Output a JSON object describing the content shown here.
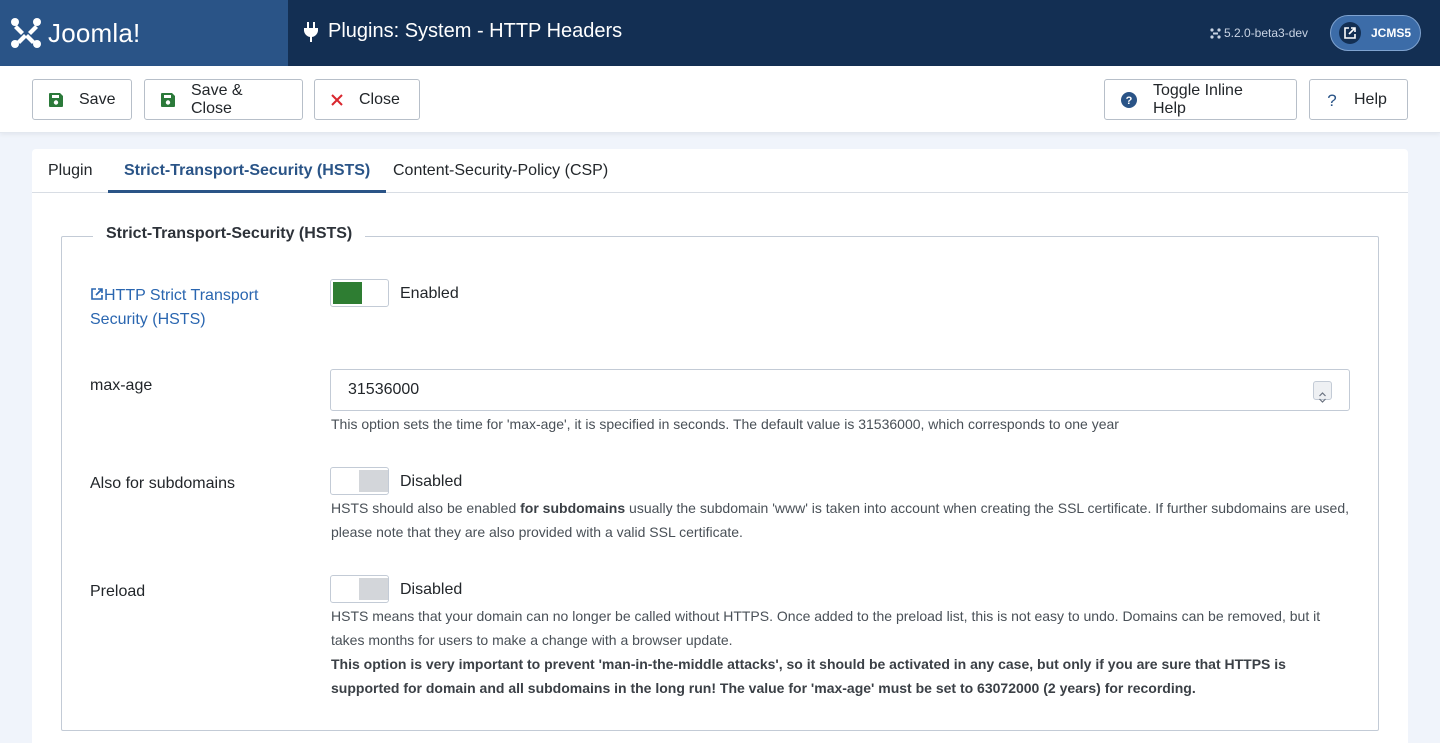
{
  "header": {
    "logo_text": "Joomla!",
    "page_title": "Plugins: System - HTTP Headers",
    "version": "5.2.0-beta3-dev",
    "site_label": "JCMS5"
  },
  "toolbar": {
    "save": "Save",
    "save_close": "Save & Close",
    "close": "Close",
    "toggle_help": "Toggle Inline Help",
    "help": "Help"
  },
  "tabs": [
    "Plugin",
    "Strict-Transport-Security (HSTS)",
    "Content-Security-Policy (CSP)"
  ],
  "active_tab": "Strict-Transport-Security (HSTS)",
  "fieldset": {
    "legend": "Strict-Transport-Security (HSTS)",
    "hsts": {
      "label": "HTTP Strict Transport Security (HSTS)",
      "state": "Enabled"
    },
    "max_age": {
      "label": "max-age",
      "value": "31536000",
      "description": "This option sets the time for 'max-age', it is specified in seconds. The default value is 31536000, which corresponds to one year"
    },
    "subdomains": {
      "label": "Also for subdomains",
      "state": "Disabled",
      "desc_pre": "HSTS should also be enabled ",
      "desc_bold": "for subdomains",
      "desc_post": " usually the subdomain 'www' is taken into account when creating the SSL certificate. If further subdomains are used, please note that they are also provided with a valid SSL certificate."
    },
    "preload": {
      "label": "Preload",
      "state": "Disabled",
      "description": "HSTS means that your domain can no longer be called without HTTPS. Once added to the preload list, this is not easy to undo. Domains can be removed, but it takes months for users to make a change with a browser update.",
      "warning": "This option is very important to prevent 'man-in-the-middle attacks', so it should be activated in any case, but only if you are sure that HTTPS is supported for domain and all subdomains in the long run! The value for 'max-age' must be set to 63072000 (2 years) for recording."
    }
  },
  "colors": {
    "header_bg": "#132f53",
    "logo_bg": "#2a5487",
    "accent": "#2a5487",
    "switch_on": "#2e7d32",
    "close_icon": "#d9272e"
  },
  "icons": [
    "joomla-logo-icon",
    "plug-icon",
    "joomla-small-icon",
    "external-link-icon",
    "save-icon",
    "close-x-icon",
    "question-circle-icon",
    "question-icon"
  ]
}
